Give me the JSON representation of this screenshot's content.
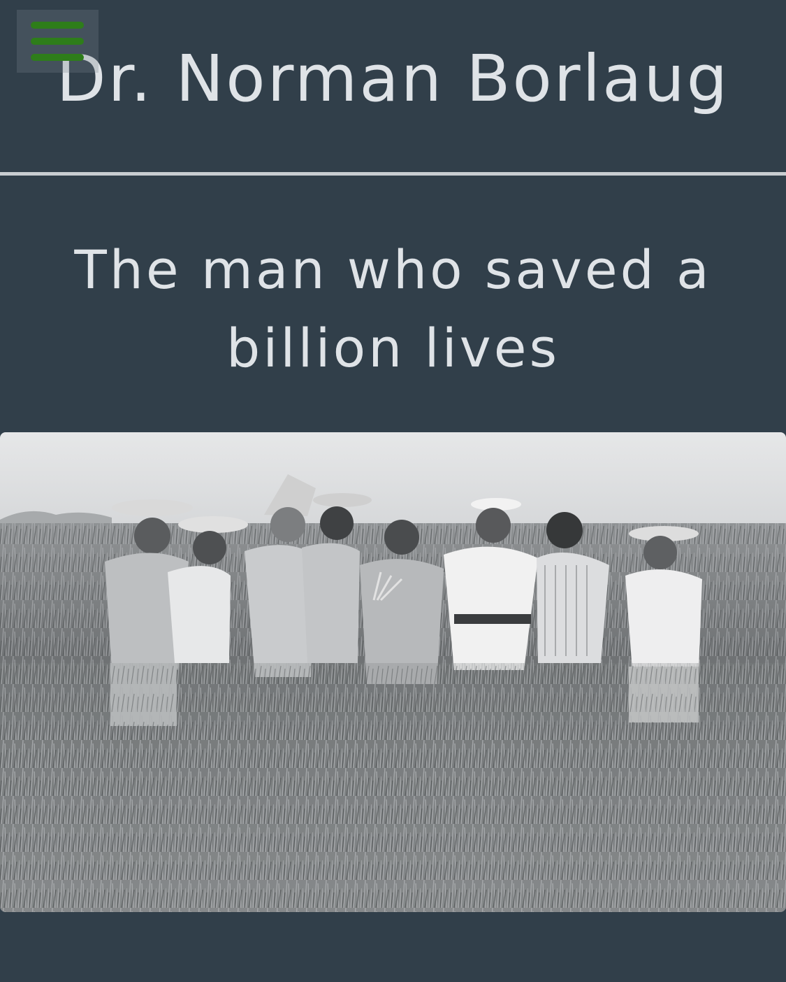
{
  "header": {
    "title": "Dr. Norman Borlaug",
    "menu_icon": "hamburger-menu-icon",
    "menu_icon_color": "#2e7d1a"
  },
  "hero": {
    "tagline": "The man who saved a billion lives",
    "image_description": "black-and-white-photo-men-in-wheat-field"
  },
  "colors": {
    "background": "#313f4a",
    "text": "#dfe3e7",
    "divider": "#c8cdd1"
  }
}
